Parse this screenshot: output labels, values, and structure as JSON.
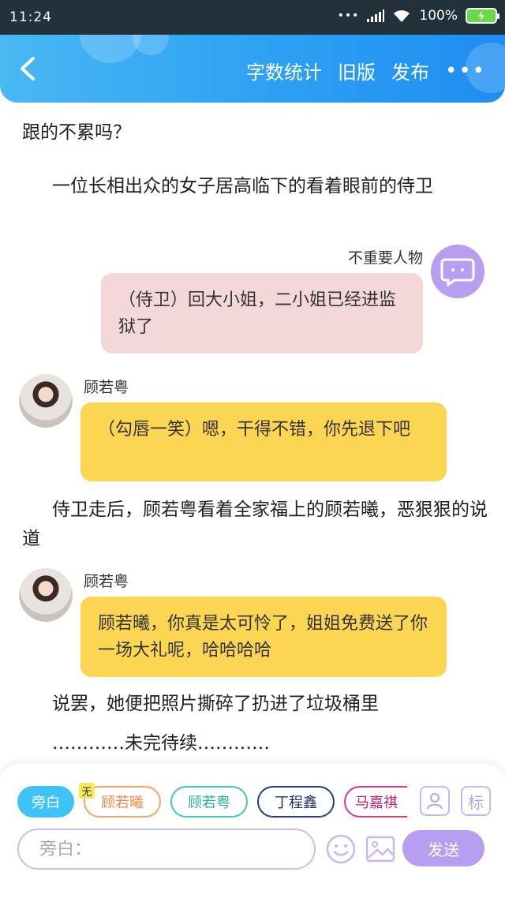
{
  "status_bar": {
    "time": "11:24",
    "battery": "100%"
  },
  "header": {
    "actions": [
      "字数统计",
      "旧版",
      "发布"
    ],
    "more": "•••"
  },
  "content": {
    "line1": "跟的不累吗？",
    "line2": "一位长相出众的女子居高临下的看着眼前的侍卫",
    "msg1": {
      "name": "不重要人物",
      "text": "（侍卫）回大小姐，二小姐已经进监狱了"
    },
    "msg2": {
      "name": "顾若粤",
      "text": "（勾唇一笑）嗯，干得不错，你先退下吧"
    },
    "line3": "侍卫走后，顾若粤看着全家福上的顾若曦，恶狠狠的说道",
    "msg3": {
      "name": "顾若粤",
      "text": "顾若曦，你真是太可怜了，姐姐免费送了你一场大礼呢，哈哈哈哈"
    },
    "line4": "说罢，她便把照片撕碎了扔进了垃圾桶里",
    "line5": "…………未完待续…………"
  },
  "input_panel": {
    "chips": [
      "旁白",
      "顾若曦",
      "顾若粤",
      "丁程鑫",
      "马嘉祺"
    ],
    "chip_tag": "无",
    "tool_label": "标",
    "input_placeholder": "旁白：",
    "send_label": "发送"
  },
  "colors": {
    "header_start": "#4ab8f3",
    "header_end": "#1f8df2",
    "bubble_pink": "#f3d7d9",
    "bubble_yellow": "#fcd653",
    "accent_purple": "#b89ef0"
  }
}
